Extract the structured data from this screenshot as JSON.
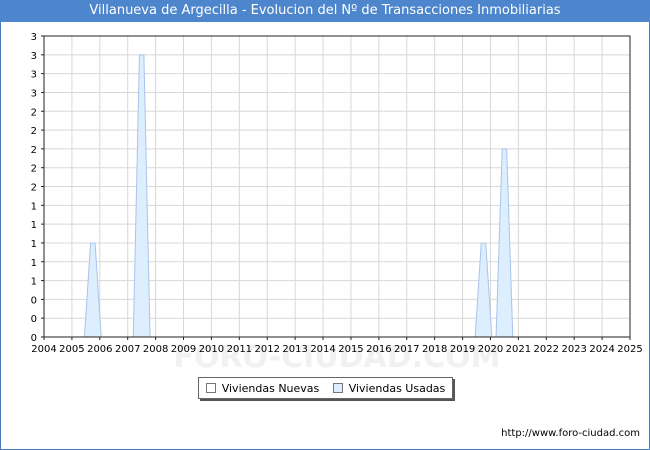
{
  "title": "Villanueva de Argecilla - Evolucion del Nº de Transacciones Inmobiliarias",
  "source": "http://www.foro-ciudad.com",
  "watermark": "FORO-CIUDAD.COM",
  "colors": {
    "title_bg": "#4d86cc",
    "nuevas": "#ffffff",
    "usadas": "#ddeeff",
    "usadas_line": "#a9c4ea",
    "grid": "#d8d8d8"
  },
  "chart_data": {
    "type": "area",
    "title": "Villanueva de Argecilla - Evolucion del Nº de Transacciones Inmobiliarias",
    "xlabel": "",
    "ylabel": "",
    "xlim": [
      2004,
      2025
    ],
    "ylim": [
      0,
      3.2
    ],
    "x_ticks": [
      "2004",
      "2005",
      "2006",
      "2007",
      "2008",
      "2009",
      "2010",
      "2011",
      "2012",
      "2013",
      "2014",
      "2015",
      "2016",
      "2017",
      "2018",
      "2019",
      "2020",
      "2021",
      "2022",
      "2023",
      "2024",
      "2025"
    ],
    "y_ticks": [
      {
        "v": 0,
        "label": "0"
      },
      {
        "v": 0.2,
        "label": "0"
      },
      {
        "v": 0.4,
        "label": "0"
      },
      {
        "v": 0.6,
        "label": "1"
      },
      {
        "v": 0.8,
        "label": "1"
      },
      {
        "v": 1.0,
        "label": "1"
      },
      {
        "v": 1.2,
        "label": "1"
      },
      {
        "v": 1.4,
        "label": "1"
      },
      {
        "v": 1.6,
        "label": "2"
      },
      {
        "v": 1.8,
        "label": "2"
      },
      {
        "v": 2.0,
        "label": "2"
      },
      {
        "v": 2.2,
        "label": "2"
      },
      {
        "v": 2.4,
        "label": "2"
      },
      {
        "v": 2.6,
        "label": "3"
      },
      {
        "v": 2.8,
        "label": "3"
      },
      {
        "v": 3.0,
        "label": "3"
      },
      {
        "v": 3.2,
        "label": "3"
      }
    ],
    "grid": true,
    "legend_position": "bottom-center",
    "series": [
      {
        "name": "Viviendas Nuevas",
        "values": []
      },
      {
        "name": "Viviendas Usadas",
        "peaks": [
          {
            "x": 2005.75,
            "y": 1
          },
          {
            "x": 2007.5,
            "y": 3
          },
          {
            "x": 2019.75,
            "y": 1
          },
          {
            "x": 2020.5,
            "y": 2
          }
        ]
      }
    ]
  }
}
